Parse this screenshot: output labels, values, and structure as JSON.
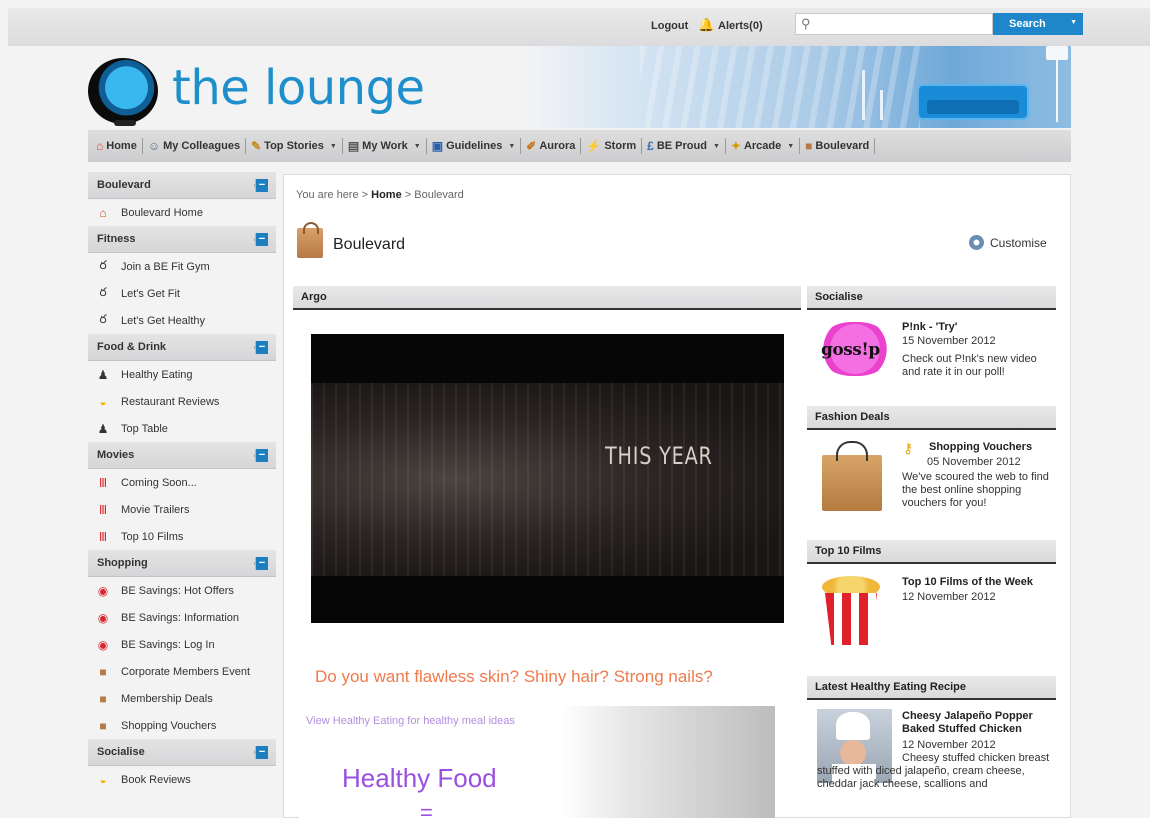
{
  "header": {
    "logout": "Logout",
    "alerts": "Alerts(0)",
    "search_placeholder": "",
    "search_button": "Search"
  },
  "brand": {
    "logo_text": "the lounge"
  },
  "nav": [
    {
      "label": "Home",
      "icon": "home-icon"
    },
    {
      "label": "My Colleagues",
      "icon": "colleagues-icon"
    },
    {
      "label": "Top Stories",
      "icon": "stories-icon",
      "dropdown": true
    },
    {
      "label": "My Work",
      "icon": "work-icon",
      "dropdown": true
    },
    {
      "label": "Guidelines",
      "icon": "guidelines-icon",
      "dropdown": true
    },
    {
      "label": "Aurora",
      "icon": "aurora-icon"
    },
    {
      "label": "Storm",
      "icon": "storm-icon"
    },
    {
      "label": "BE Proud",
      "icon": "proud-icon",
      "dropdown": true
    },
    {
      "label": "Arcade",
      "icon": "arcade-icon",
      "dropdown": true
    },
    {
      "label": "Boulevard",
      "icon": "bag-icon"
    }
  ],
  "sidebar": {
    "sections": [
      {
        "title": "Boulevard",
        "items": [
          "Boulevard Home"
        ]
      },
      {
        "title": "Fitness",
        "items": [
          "Join a BE Fit Gym",
          "Let's Get Fit",
          "Let's Get Healthy"
        ]
      },
      {
        "title": "Food & Drink",
        "items": [
          "Healthy Eating",
          "Restaurant Reviews",
          "Top Table"
        ]
      },
      {
        "title": "Movies",
        "items": [
          "Coming Soon...",
          "Movie Trailers",
          "Top 10 Films"
        ]
      },
      {
        "title": "Shopping",
        "items": [
          "BE Savings: Hot Offers",
          "BE Savings: Information",
          "BE Savings: Log In",
          "Corporate Members Event",
          "Membership Deals",
          "Shopping Vouchers"
        ]
      },
      {
        "title": "Socialise",
        "items": [
          "Book Reviews"
        ]
      }
    ]
  },
  "main": {
    "breadcrumb_prefix": "You are here >",
    "breadcrumb_home": "Home",
    "breadcrumb_current": "> Boulevard",
    "page_title": "Boulevard",
    "customise": "Customise",
    "video_section": "Argo",
    "video_caption": "THIS YEAR",
    "promo_headline": "Do you want flawless skin? Shiny hair? Strong nails?",
    "promo_link": "View Healthy Eating for healthy meal ideas",
    "promo_big": "Healthy Food",
    "promo_eq": "="
  },
  "right": {
    "socialise": {
      "heading": "Socialise",
      "image_text": "goss!p",
      "title": "P!nk - 'Try'",
      "date": "15 November 2012",
      "text": "Check out P!nk's new video and rate it in our poll!"
    },
    "fashion": {
      "heading": "Fashion Deals",
      "title": "Shopping Vouchers",
      "date": "05 November 2012",
      "text": "We've scoured the web to find the best online shopping vouchers for you!"
    },
    "films": {
      "heading": "Top 10 Films",
      "title": "Top 10 Films of the Week",
      "date": "12 November 2012"
    },
    "recipe": {
      "heading": "Latest Healthy Eating Recipe",
      "title": "Cheesy Jalapeño Popper Baked Stuffed Chicken",
      "date": "12 November 2012",
      "text": "Cheesy stuffed chicken breast stuffed with diced jalapeño, cream cheese, cheddar jack cheese, scallions and"
    }
  },
  "colors": {
    "accent": "#1e8fcb",
    "search_button": "#1f86c9",
    "promo": "#f07a4a",
    "promo_big": "#9b4fe0"
  }
}
